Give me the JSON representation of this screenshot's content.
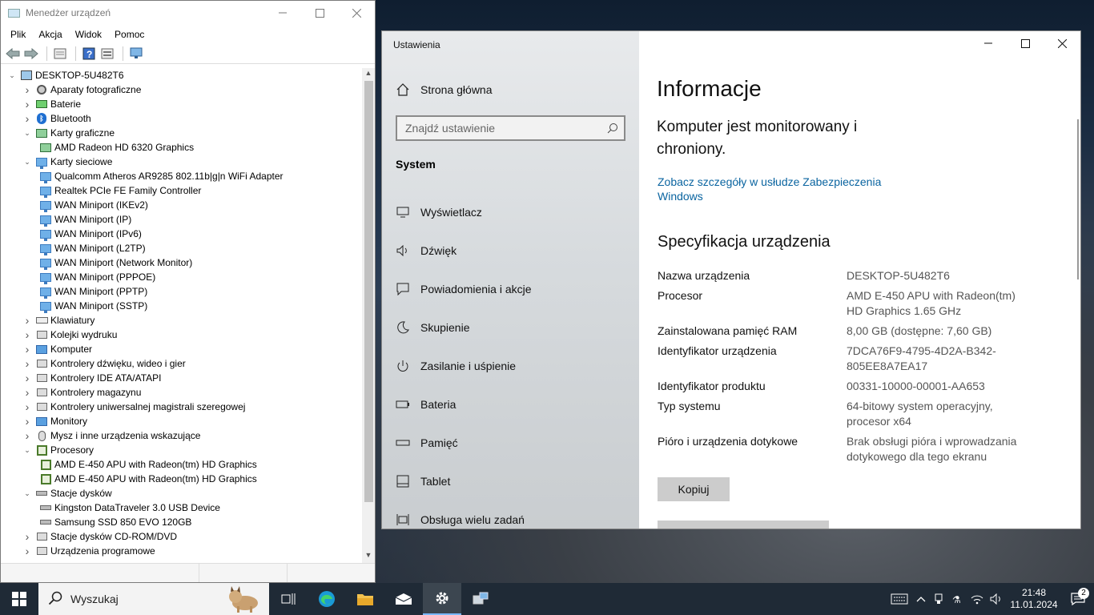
{
  "device_manager": {
    "title": "Menedżer urządzeń",
    "menu": [
      "Plik",
      "Akcja",
      "Widok",
      "Pomoc"
    ],
    "root": "DESKTOP-5U482T6",
    "tree": [
      {
        "label": "Aparaty fotograficzne",
        "level": 1,
        "state": "collapsed",
        "icon": "camera-icon"
      },
      {
        "label": "Baterie",
        "level": 1,
        "state": "collapsed",
        "icon": "battery-icon"
      },
      {
        "label": "Bluetooth",
        "level": 1,
        "state": "collapsed",
        "icon": "bluetooth-icon"
      },
      {
        "label": "Karty graficzne",
        "level": 1,
        "state": "expanded",
        "icon": "display-adapter-icon"
      },
      {
        "label": "AMD Radeon HD 6320 Graphics",
        "level": 2,
        "state": "leaf",
        "icon": "display-adapter-icon"
      },
      {
        "label": "Karty sieciowe",
        "level": 1,
        "state": "expanded",
        "icon": "network-adapter-icon"
      },
      {
        "label": "Qualcomm Atheros AR9285 802.11b|g|n WiFi Adapter",
        "level": 2,
        "state": "leaf",
        "icon": "network-adapter-icon"
      },
      {
        "label": "Realtek PCIe FE Family Controller",
        "level": 2,
        "state": "leaf",
        "icon": "network-adapter-icon"
      },
      {
        "label": "WAN Miniport (IKEv2)",
        "level": 2,
        "state": "leaf",
        "icon": "network-adapter-icon"
      },
      {
        "label": "WAN Miniport (IP)",
        "level": 2,
        "state": "leaf",
        "icon": "network-adapter-icon"
      },
      {
        "label": "WAN Miniport (IPv6)",
        "level": 2,
        "state": "leaf",
        "icon": "network-adapter-icon"
      },
      {
        "label": "WAN Miniport (L2TP)",
        "level": 2,
        "state": "leaf",
        "icon": "network-adapter-icon"
      },
      {
        "label": "WAN Miniport (Network Monitor)",
        "level": 2,
        "state": "leaf",
        "icon": "network-adapter-icon"
      },
      {
        "label": "WAN Miniport (PPPOE)",
        "level": 2,
        "state": "leaf",
        "icon": "network-adapter-icon"
      },
      {
        "label": "WAN Miniport (PPTP)",
        "level": 2,
        "state": "leaf",
        "icon": "network-adapter-icon"
      },
      {
        "label": "WAN Miniport (SSTP)",
        "level": 2,
        "state": "leaf",
        "icon": "network-adapter-icon"
      },
      {
        "label": "Klawiatury",
        "level": 1,
        "state": "collapsed",
        "icon": "keyboard-icon"
      },
      {
        "label": "Kolejki wydruku",
        "level": 1,
        "state": "collapsed",
        "icon": "printer-icon"
      },
      {
        "label": "Komputer",
        "level": 1,
        "state": "collapsed",
        "icon": "computer-icon"
      },
      {
        "label": "Kontrolery dźwięku, wideo i gier",
        "level": 1,
        "state": "collapsed",
        "icon": "speaker-icon"
      },
      {
        "label": "Kontrolery IDE ATA/ATAPI",
        "level": 1,
        "state": "collapsed",
        "icon": "ide-controller-icon"
      },
      {
        "label": "Kontrolery magazynu",
        "level": 1,
        "state": "collapsed",
        "icon": "storage-controller-icon"
      },
      {
        "label": "Kontrolery uniwersalnej magistrali szeregowej",
        "level": 1,
        "state": "collapsed",
        "icon": "usb-icon"
      },
      {
        "label": "Monitory",
        "level": 1,
        "state": "collapsed",
        "icon": "monitor-icon"
      },
      {
        "label": "Mysz i inne urządzenia wskazujące",
        "level": 1,
        "state": "collapsed",
        "icon": "mouse-icon"
      },
      {
        "label": "Procesory",
        "level": 1,
        "state": "expanded",
        "icon": "processor-icon"
      },
      {
        "label": "AMD E-450 APU with Radeon(tm) HD Graphics",
        "level": 2,
        "state": "leaf",
        "icon": "processor-icon"
      },
      {
        "label": "AMD E-450 APU with Radeon(tm) HD Graphics",
        "level": 2,
        "state": "leaf",
        "icon": "processor-icon"
      },
      {
        "label": "Stacje dysków",
        "level": 1,
        "state": "expanded",
        "icon": "disk-drive-icon"
      },
      {
        "label": "Kingston DataTraveler 3.0 USB Device",
        "level": 2,
        "state": "leaf",
        "icon": "disk-drive-icon"
      },
      {
        "label": "Samsung SSD 850 EVO 120GB",
        "level": 2,
        "state": "leaf",
        "icon": "disk-drive-icon"
      },
      {
        "label": "Stacje dysków CD-ROM/DVD",
        "level": 1,
        "state": "collapsed",
        "icon": "cd-drive-icon"
      },
      {
        "label": "Urządzenia programowe",
        "level": 1,
        "state": "collapsed",
        "icon": "software-device-icon"
      }
    ]
  },
  "settings": {
    "app_title": "Ustawienia",
    "home": "Strona główna",
    "search_placeholder": "Znajdź ustawienie",
    "section": "System",
    "nav": [
      {
        "label": "Wyświetlacz",
        "icon": "display-icon"
      },
      {
        "label": "Dźwięk",
        "icon": "sound-icon"
      },
      {
        "label": "Powiadomienia i akcje",
        "icon": "notifications-icon"
      },
      {
        "label": "Skupienie",
        "icon": "focus-moon-icon"
      },
      {
        "label": "Zasilanie i uśpienie",
        "icon": "power-icon"
      },
      {
        "label": "Bateria",
        "icon": "battery-icon"
      },
      {
        "label": "Pamięć",
        "icon": "storage-icon"
      },
      {
        "label": "Tablet",
        "icon": "tablet-icon"
      },
      {
        "label": "Obsługa wielu zadań",
        "icon": "multitasking-icon"
      }
    ],
    "page_title": "Informacje",
    "protected_text": "Komputer jest monitorowany i chroniony.",
    "security_link": "Zobacz szczegóły w usłudze Zabezpieczenia Windows",
    "spec_heading": "Specyfikacja urządzenia",
    "specs": [
      {
        "key": "Nazwa urządzenia",
        "value": "DESKTOP-5U482T6"
      },
      {
        "key": "Procesor",
        "value": "AMD E-450 APU with Radeon(tm) HD Graphics   1.65 GHz"
      },
      {
        "key": "Zainstalowana pamięć RAM",
        "value": "8,00 GB (dostępne: 7,60 GB)"
      },
      {
        "key": "Identyfikator urządzenia",
        "value": "7DCA76F9-4795-4D2A-B342-805EE8A7EA17"
      },
      {
        "key": "Identyfikator produktu",
        "value": "00331-10000-00001-AA653"
      },
      {
        "key": "Typ systemu",
        "value": "64-bitowy system operacyjny, procesor x64"
      },
      {
        "key": "Pióro i urządzenia dotykowe",
        "value": "Brak obsługi pióra i wprowadzania dotykowego dla tego ekranu"
      }
    ],
    "copy_button": "Kopiuj"
  },
  "taskbar": {
    "search_placeholder": "Wyszukaj",
    "apps": [
      "task-view-icon",
      "edge-icon",
      "file-explorer-icon",
      "mail-icon",
      "settings-icon",
      "device-manager-icon"
    ],
    "time": "21:48",
    "date": "11.01.2024",
    "notifications_count": "2"
  }
}
